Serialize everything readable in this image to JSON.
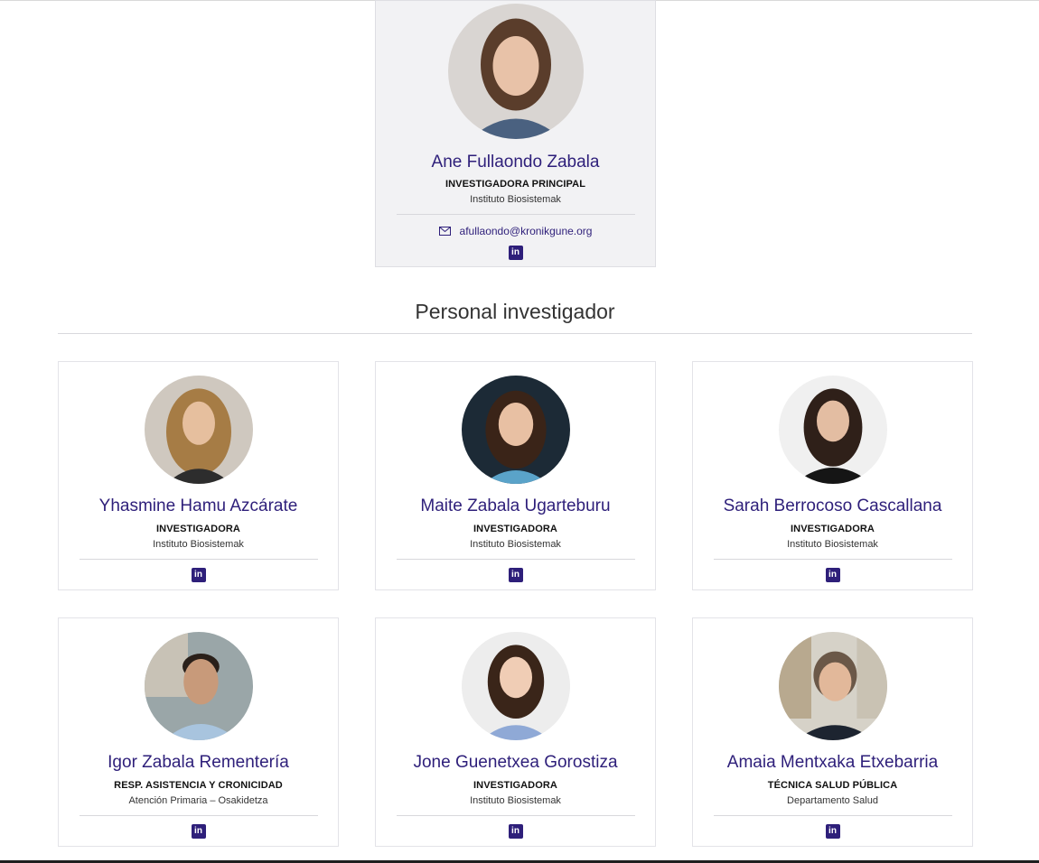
{
  "colors": {
    "accent": "#2e1f7a",
    "lead_card_bg": "#f2f2f4",
    "card_border": "#e3e3e8"
  },
  "lead": {
    "name": "Ane Fullaondo Zabala",
    "role": "INVESTIGADORA PRINCIPAL",
    "org": "Instituto Biosistemak",
    "email": "afullaondo@kronikgune.org",
    "email_icon": "envelope-icon",
    "linkedin_icon": "linkedin-icon",
    "linkedin_glyph": "in"
  },
  "section": {
    "title": "Personal investigador"
  },
  "researchers": [
    {
      "name": "Yhasmine Hamu Azcárate",
      "role": "INVESTIGADORA",
      "org": "Instituto Biosistemak",
      "linkedin_glyph": "in"
    },
    {
      "name": "Maite Zabala Ugarteburu",
      "role": "INVESTIGADORA",
      "org": "Instituto Biosistemak",
      "linkedin_glyph": "in"
    },
    {
      "name": "Sarah Berrocoso Cascallana",
      "role": "INVESTIGADORA",
      "org": "Instituto Biosistemak",
      "linkedin_glyph": "in"
    },
    {
      "name": "Igor Zabala Rementería",
      "role": "RESP. ASISTENCIA Y CRONICIDAD",
      "org": "Atención Primaria – Osakidetza",
      "linkedin_glyph": "in"
    },
    {
      "name": "Jone Guenetxea Gorostiza",
      "role": "INVESTIGADORA",
      "org": "Instituto Biosistemak",
      "linkedin_glyph": "in"
    },
    {
      "name": "Amaia Mentxaka Etxebarria",
      "role": "TÉCNICA SALUD PÚBLICA",
      "org": "Departamento Salud",
      "linkedin_glyph": "in"
    }
  ]
}
